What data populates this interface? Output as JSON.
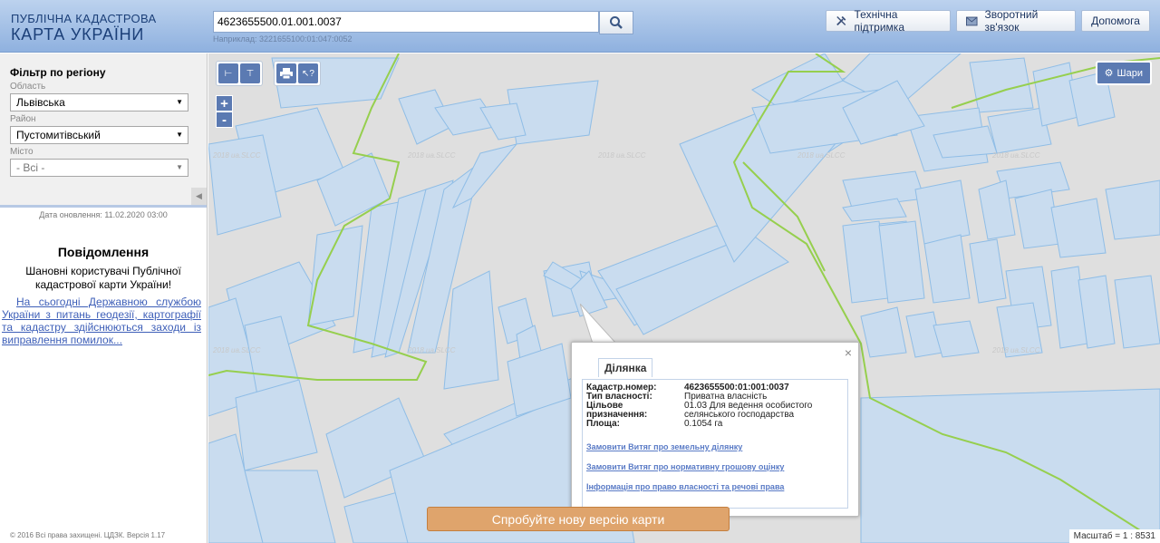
{
  "header": {
    "logo_line1": "ПУБЛІЧНА КАДАСТРОВА",
    "logo_line2": "КАРТА УКРАЇНИ",
    "search_value": "4623655500.01.001.0037",
    "search_hint": "Наприклад: 3221655100:01:047:0052",
    "buttons": [
      "Технічна підтримка",
      "Зворотний зв'язок",
      "Допомога"
    ]
  },
  "sidebar": {
    "filter_title": "Фільтр по регіону",
    "fields": [
      {
        "label": "Область",
        "value": "Львівська"
      },
      {
        "label": "Район",
        "value": "Пустомитівський"
      },
      {
        "label": "Місто",
        "value": "- Всі -"
      }
    ],
    "updated": "Дата оновлення: 11.02.2020 03:00",
    "notice_title": "Повідомлення",
    "notice_text": "Шановні користувачі Публічної кадастрової карти України!",
    "notice_link": "На сьогодні Державною службою України з питань геодезії, картографії та кадастру здійснюються заходи із виправлення помилок...",
    "copyright": "© 2016 Всі права захищені. ЦДЗК. Версія 1.17"
  },
  "map": {
    "layers_label": "Шари",
    "zoom_in": "+",
    "zoom_out": "-",
    "watermark": "2018 ua.SLCC",
    "popup": {
      "tab": "Ділянка",
      "rows": [
        {
          "k": "Кадастр.номер:",
          "v": "4623655500:01:001:0037"
        },
        {
          "k": "Тип власності:",
          "v": "Приватна власність"
        },
        {
          "k": "Цільове призначення:",
          "v": "01.03 Для ведення особистого селянського господарства"
        },
        {
          "k": "Площа:",
          "v": "0.1054 га"
        }
      ],
      "links": [
        "Замовити Витяг про земельну ділянку",
        "Замовити Витяг про нормативну грошову оцінку",
        "Інформація про право власності та речові права"
      ]
    },
    "try_new": "Спробуйте нову версію карти",
    "scale": "Масштаб = 1 : 8531"
  }
}
